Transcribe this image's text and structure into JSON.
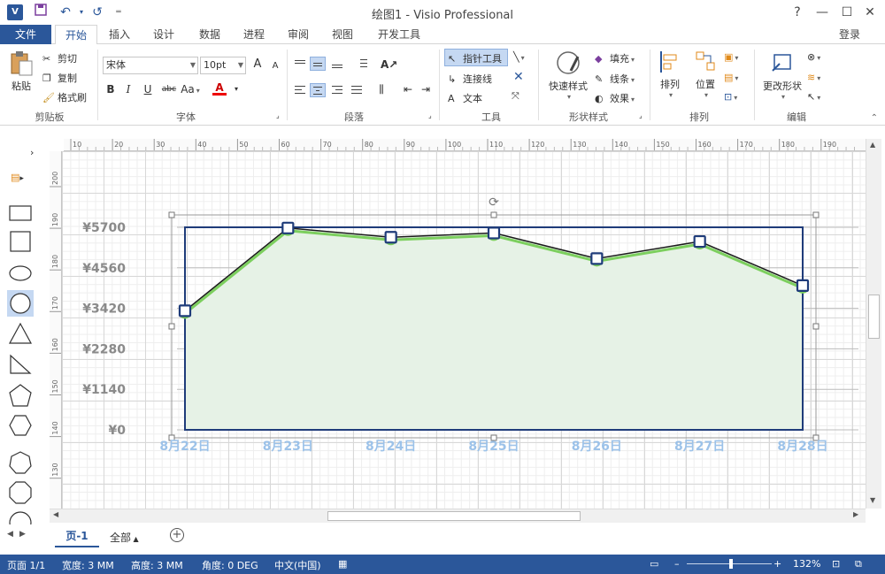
{
  "titlebar": {
    "title": "绘图1 - Visio Professional",
    "app_icon": "V",
    "help": "?",
    "minimize": "—",
    "maximize": "☐",
    "close": "✕",
    "undo_icon": "↶",
    "redo_icon": "↺",
    "save_icon": "save-icon"
  },
  "tabs": {
    "file": "文件",
    "items": [
      "开始",
      "插入",
      "设计",
      "数据",
      "进程",
      "审阅",
      "视图",
      "开发工具"
    ],
    "active": "开始",
    "login": "登录"
  },
  "ribbon": {
    "clipboard": {
      "paste": "粘贴",
      "cut": "剪切",
      "copy": "复制",
      "format_painter": "格式刷",
      "label": "剪贴板"
    },
    "font": {
      "family": "宋体",
      "size": "10pt",
      "bold": "B",
      "italic": "I",
      "underline": "U",
      "strike": "abc",
      "case": "Aa",
      "color_letter": "A",
      "grow": "A",
      "shrink": "A",
      "label": "字体"
    },
    "paragraph": {
      "label": "段落"
    },
    "tools": {
      "pointer": "指针工具",
      "connector": "连接线",
      "text": "文本",
      "text_glyph": "A",
      "label": "工具"
    },
    "shape_styles": {
      "quick": "快速样式",
      "fill": "填充",
      "line": "线条",
      "effects": "效果",
      "label": "形状样式"
    },
    "arrange": {
      "arrange": "排列",
      "position": "位置",
      "label": "排列"
    },
    "editing": {
      "change_shape": "更改形状",
      "label": "编辑"
    }
  },
  "chart_data": {
    "type": "area",
    "categories": [
      "8月22日",
      "8月23日",
      "8月24日",
      "8月25日",
      "8月26日",
      "8月27日",
      "8月28日"
    ],
    "series": [
      {
        "values": [
          3350,
          5680,
          5420,
          5540,
          4820,
          5300,
          4060
        ]
      }
    ],
    "yticks": [
      "¥5700",
      "¥4560",
      "¥3420",
      "¥2280",
      "¥1140",
      "¥0"
    ],
    "ylim": [
      0,
      5700
    ],
    "fill_color": "#e6f2e6",
    "line_color": "#1a1a1a",
    "highlight_color": "#7ccf5e",
    "marker_color": "#1f3c7a"
  },
  "rulers": {
    "top": [
      "10",
      "20",
      "30",
      "40",
      "50",
      "60",
      "70",
      "80",
      "90",
      "100",
      "110",
      "120",
      "130",
      "140",
      "150",
      "160",
      "170",
      "180",
      "190"
    ],
    "left": [
      "200",
      "190",
      "180",
      "170",
      "160",
      "150",
      "140",
      "130"
    ]
  },
  "pagebar": {
    "page": "页-1",
    "all": "全部"
  },
  "status": {
    "page": "页面 1/1",
    "width": "宽度: 3 MM",
    "height": "高度: 3 MM",
    "angle": "角度: 0 DEG",
    "language": "中文(中国)",
    "zoom": "132%"
  },
  "colors": {
    "brand": "#2b579a",
    "selection": "#c5d8f2"
  }
}
